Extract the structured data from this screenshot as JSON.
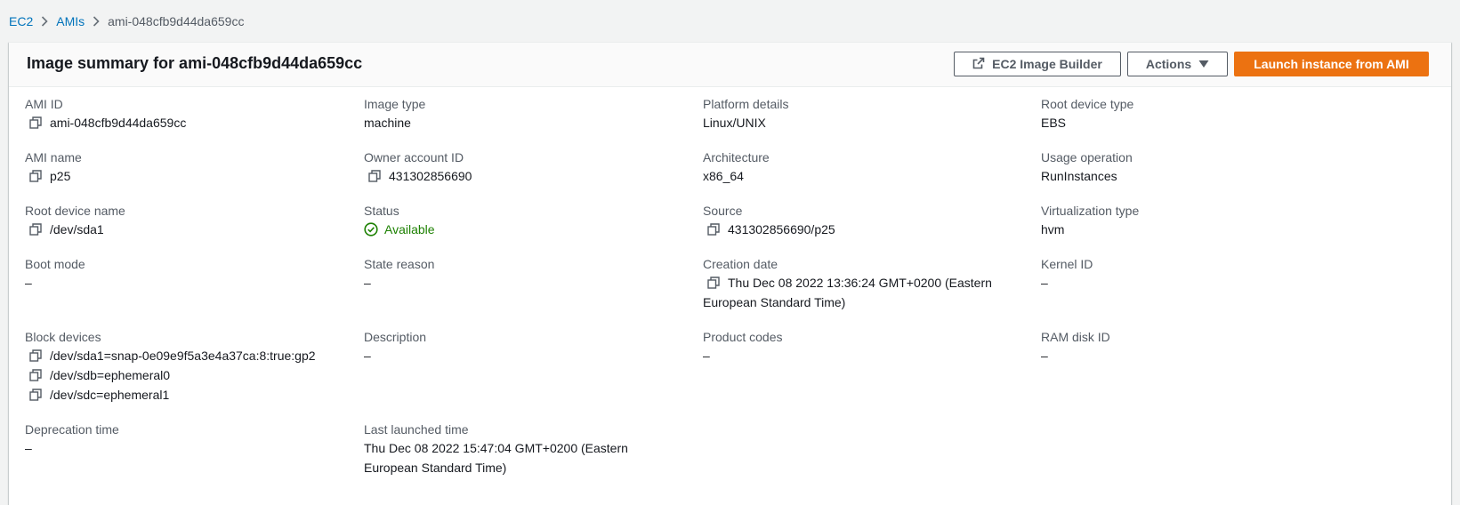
{
  "breadcrumb": {
    "items": [
      "EC2",
      "AMIs"
    ],
    "current": "ami-048cfb9d44da659cc"
  },
  "header": {
    "title": "Image summary for ami-048cfb9d44da659cc",
    "builder_label": "EC2 Image Builder",
    "actions_label": "Actions",
    "launch_label": "Launch instance from AMI"
  },
  "fields": {
    "ami_id": {
      "label": "AMI ID",
      "value": "ami-048cfb9d44da659cc"
    },
    "image_type": {
      "label": "Image type",
      "value": "machine"
    },
    "platform_details": {
      "label": "Platform details",
      "value": "Linux/UNIX"
    },
    "root_device_type": {
      "label": "Root device type",
      "value": "EBS"
    },
    "ami_name": {
      "label": "AMI name",
      "value": "p25"
    },
    "owner_account_id": {
      "label": "Owner account ID",
      "value": "431302856690"
    },
    "architecture": {
      "label": "Architecture",
      "value": "x86_64"
    },
    "usage_operation": {
      "label": "Usage operation",
      "value": "RunInstances"
    },
    "root_device_name": {
      "label": "Root device name",
      "value": "/dev/sda1"
    },
    "status": {
      "label": "Status",
      "value": "Available"
    },
    "source": {
      "label": "Source",
      "value": "431302856690/p25"
    },
    "virtualization_type": {
      "label": "Virtualization type",
      "value": "hvm"
    },
    "boot_mode": {
      "label": "Boot mode",
      "value": "–"
    },
    "state_reason": {
      "label": "State reason",
      "value": "–"
    },
    "creation_date": {
      "label": "Creation date",
      "value": "Thu Dec 08 2022 13:36:24 GMT+0200 (Eastern European Standard Time)"
    },
    "kernel_id": {
      "label": "Kernel ID",
      "value": "–"
    },
    "block_devices": {
      "label": "Block devices",
      "values": [
        "/dev/sda1=snap-0e09e9f5a3e4a37ca:8:true:gp2",
        "/dev/sdb=ephemeral0",
        "/dev/sdc=ephemeral1"
      ]
    },
    "description": {
      "label": "Description",
      "value": "–"
    },
    "product_codes": {
      "label": "Product codes",
      "value": "–"
    },
    "ram_disk_id": {
      "label": "RAM disk ID",
      "value": "–"
    },
    "deprecation_time": {
      "label": "Deprecation time",
      "value": "–"
    },
    "last_launched_time": {
      "label": "Last launched time",
      "value": "Thu Dec 08 2022 15:47:04 GMT+0200 (Eastern European Standard Time)"
    }
  },
  "colors": {
    "link": "#0073bb",
    "primary": "#ec7211",
    "success": "#1d8102"
  },
  "icons": {
    "copy": "copy-icon",
    "external": "external-link-icon",
    "caret": "caret-down-icon",
    "status": "status-check-icon",
    "chevron": "chevron-right-icon"
  }
}
